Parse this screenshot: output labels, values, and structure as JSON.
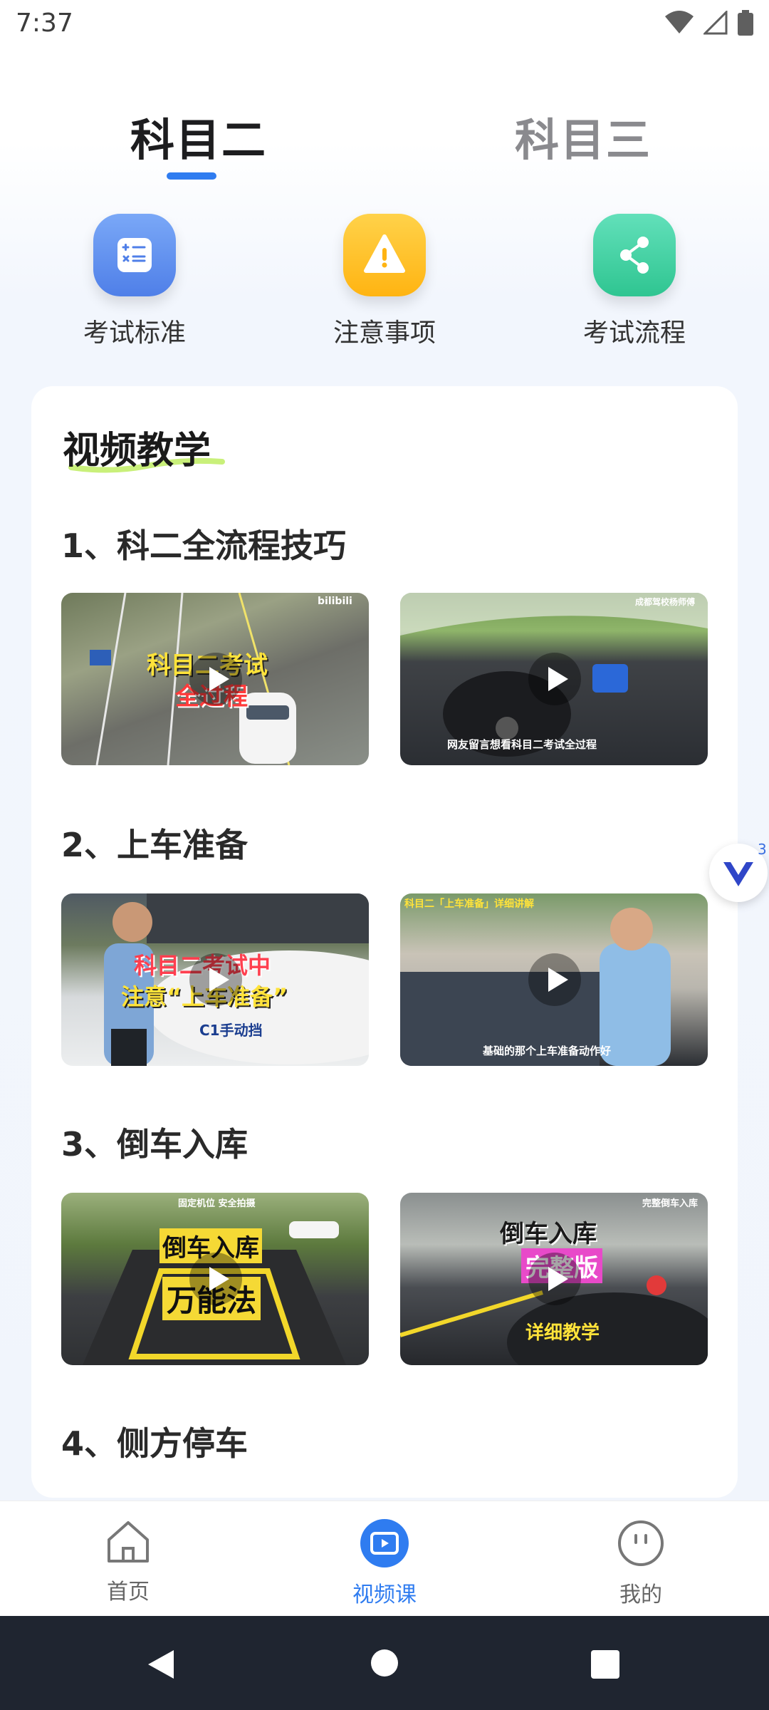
{
  "status": {
    "time": "7:37"
  },
  "tabs": [
    {
      "label": "科目二",
      "active": true
    },
    {
      "label": "科目三",
      "active": false
    }
  ],
  "quick_items": [
    {
      "label": "考试标准",
      "icon": "calculator-icon"
    },
    {
      "label": "注意事项",
      "icon": "warning-icon"
    },
    {
      "label": "考试流程",
      "icon": "share-icon"
    }
  ],
  "card": {
    "title": "视频教学",
    "sections": [
      {
        "title": "1、科二全流程技巧",
        "videos": [
          {
            "caption_line1": "科目二考试",
            "caption_line2": "全过程",
            "tag": "bilibili"
          },
          {
            "caption": "网友留言想看科目二考试全过程",
            "tag": "成都驾校杨师傅"
          }
        ]
      },
      {
        "title": "2、上车准备",
        "videos": [
          {
            "caption_line1": "科目二考试中",
            "caption_line2": "注意“上车准备”",
            "sub": "C1手动挡"
          },
          {
            "caption": "基础的那个上车准备动作好",
            "tag": "科目二「上车准备」详细讲解"
          }
        ]
      },
      {
        "title": "3、倒车入库",
        "videos": [
          {
            "caption_line1": "倒车入库",
            "caption_line2": "万能法",
            "tag": "固定机位 安全拍摄"
          },
          {
            "caption_line1": "倒车入库",
            "caption_line2": "完整版",
            "sub": "详细教学",
            "tag": "完整倒车入库"
          }
        ]
      },
      {
        "title": "4、侧方停车",
        "videos": []
      }
    ]
  },
  "floating_badge": {
    "count": "3"
  },
  "bottom_nav": [
    {
      "label": "首页",
      "icon": "home-icon",
      "active": false
    },
    {
      "label": "视频课",
      "icon": "video-icon",
      "active": true
    },
    {
      "label": "我的",
      "icon": "profile-icon",
      "active": false
    }
  ],
  "colors": {
    "accent": "#2f7cf0",
    "blue_icon": "#5d8ef0",
    "yellow_icon": "#ffc21e",
    "green_icon": "#3fd3a6"
  }
}
